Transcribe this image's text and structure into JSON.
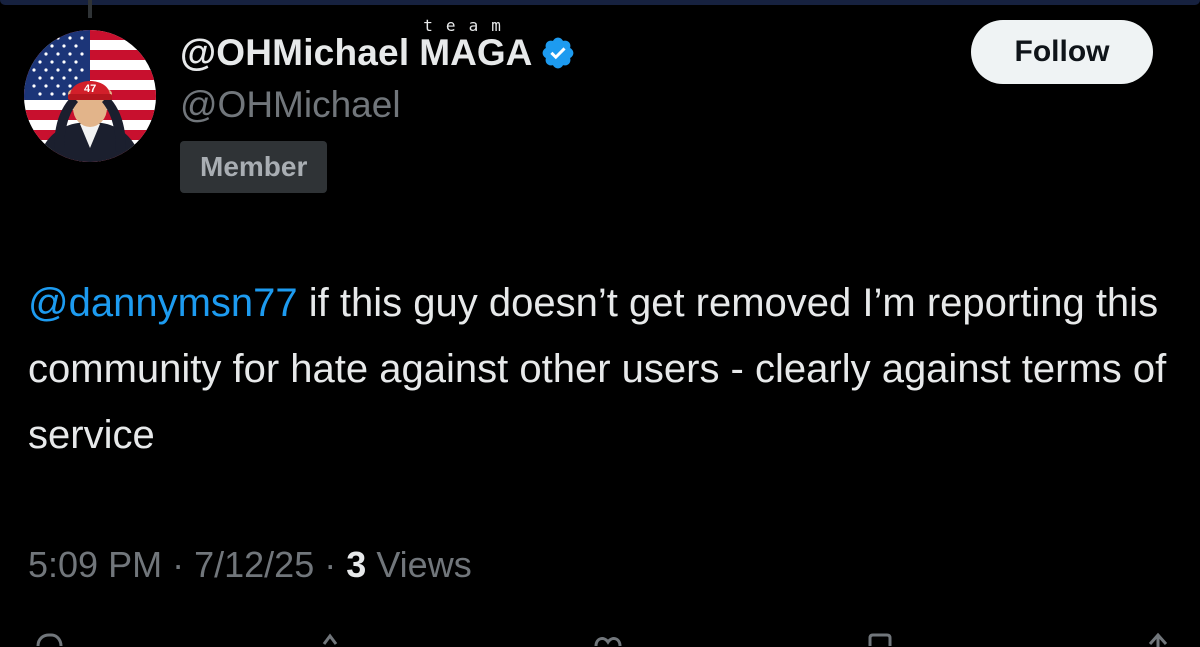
{
  "post": {
    "author": {
      "display_name": "@OHMichael",
      "name_suffix": "MAGA",
      "name_superscript": "team",
      "handle": "@OHMichael",
      "verified": true,
      "avatar_cap_text": "47"
    },
    "member_badge": "Member",
    "follow_label": "Follow",
    "body": {
      "mention": "@dannymsn77",
      "text": " if this guy doesn’t get removed I’m reporting this community for hate against other users - clearly against terms of service"
    },
    "meta": {
      "time": "5:09 PM",
      "separator": "·",
      "date": "7/12/25",
      "views_count": "3",
      "views_label": "Views"
    },
    "actions": [
      "reply-icon",
      "repost-icon",
      "like-icon",
      "bookmark-icon",
      "share-icon"
    ]
  },
  "colors": {
    "background": "#000000",
    "text_primary": "#e7e9ea",
    "text_secondary": "#71767b",
    "link": "#1d9bf0",
    "verified_badge": "#1d9bf0",
    "badge_bg": "#2f3336",
    "follow_bg": "#eff3f4"
  }
}
